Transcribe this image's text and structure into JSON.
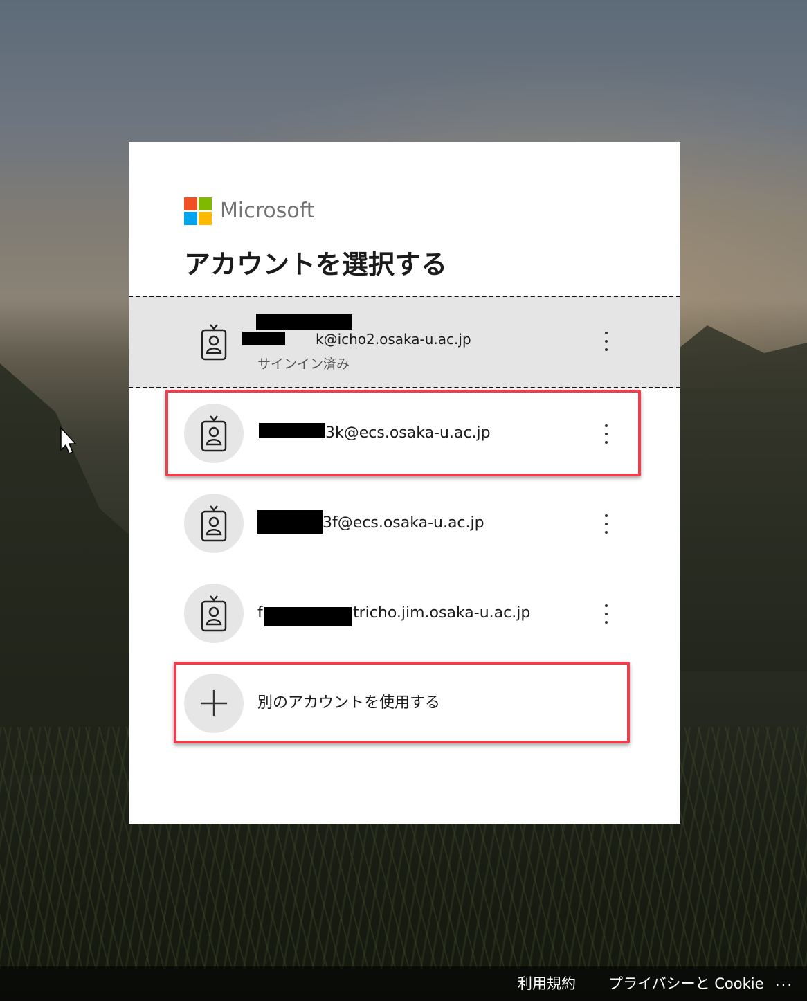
{
  "brand": {
    "name": "Microsoft",
    "colors": [
      "#f25022",
      "#7fba00",
      "#00a4ef",
      "#ffb900"
    ]
  },
  "title": "アカウントを選択する",
  "accounts": [
    {
      "email_visible": "k@icho2.osaka-u.ac.jp",
      "status": "サインイン済み",
      "selected": true,
      "icon": "badge-person-icon",
      "menu_icon": "more-options-icon"
    },
    {
      "email_visible": "3k@ecs.osaka-u.ac.jp",
      "selected": false,
      "icon": "badge-person-icon",
      "menu_icon": "more-options-icon"
    },
    {
      "email_visible": "3f@ecs.osaka-u.ac.jp",
      "selected": false,
      "icon": "badge-person-icon",
      "menu_icon": "more-options-icon"
    },
    {
      "email_prefix": "f",
      "email_visible": "tricho.jim.osaka-u.ac.jp",
      "selected": false,
      "icon": "badge-person-icon",
      "menu_icon": "more-options-icon"
    }
  ],
  "add_account": {
    "label": "別のアカウントを使用する",
    "icon": "plus-icon"
  },
  "footer": {
    "terms": "利用規約",
    "privacy": "プライバシーと Cookie",
    "more": "..."
  },
  "annotation": {
    "highlight_color": "#e8414d"
  }
}
